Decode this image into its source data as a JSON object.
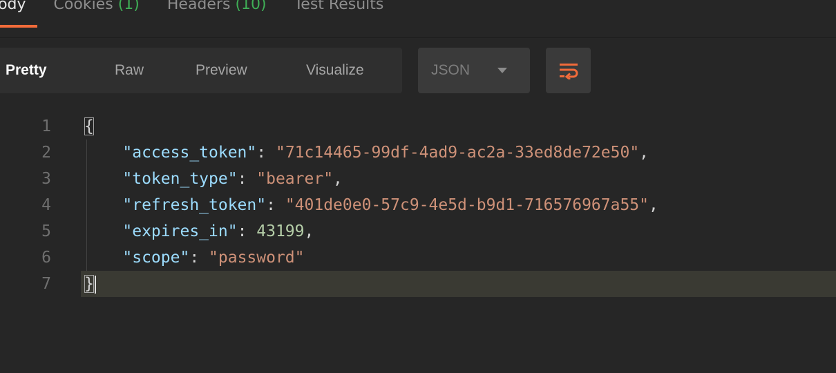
{
  "response_tabs": [
    {
      "label": "Body",
      "count": ""
    },
    {
      "label": "Cookies",
      "count": "(1)"
    },
    {
      "label": "Headers",
      "count": "(10)"
    },
    {
      "label": "Test Results",
      "count": ""
    }
  ],
  "view_modes": {
    "pretty": "Pretty",
    "raw": "Raw",
    "preview": "Preview",
    "visualize": "Visualize",
    "active": "Pretty"
  },
  "format_select": {
    "value": "JSON",
    "icon": "chevron-down-icon"
  },
  "wrap_button": {
    "icon": "wrap-lines-icon"
  },
  "colors": {
    "accent": "#f26b3a",
    "background": "#262626",
    "key": "#9cdcfe",
    "string": "#ce9178",
    "number": "#b5cea8",
    "count_green": "#3fae56"
  },
  "editor": {
    "line_numbers": [
      "1",
      "2",
      "3",
      "4",
      "5",
      "6",
      "7"
    ],
    "open_brace": "{",
    "close_brace": "}",
    "fields": [
      {
        "key": "\"access_token\"",
        "value": "\"71c14465-99df-4ad9-ac2a-33ed8de72e50\"",
        "type": "string",
        "trail": ","
      },
      {
        "key": "\"token_type\"",
        "value": "\"bearer\"",
        "type": "string",
        "trail": ","
      },
      {
        "key": "\"refresh_token\"",
        "value": "\"401de0e0-57c9-4e5d-b9d1-716576967a55\"",
        "type": "string",
        "trail": ","
      },
      {
        "key": "\"expires_in\"",
        "value": "43199",
        "type": "number",
        "trail": ","
      },
      {
        "key": "\"scope\"",
        "value": "\"password\"",
        "type": "string",
        "trail": ""
      }
    ],
    "current_line": "7"
  }
}
